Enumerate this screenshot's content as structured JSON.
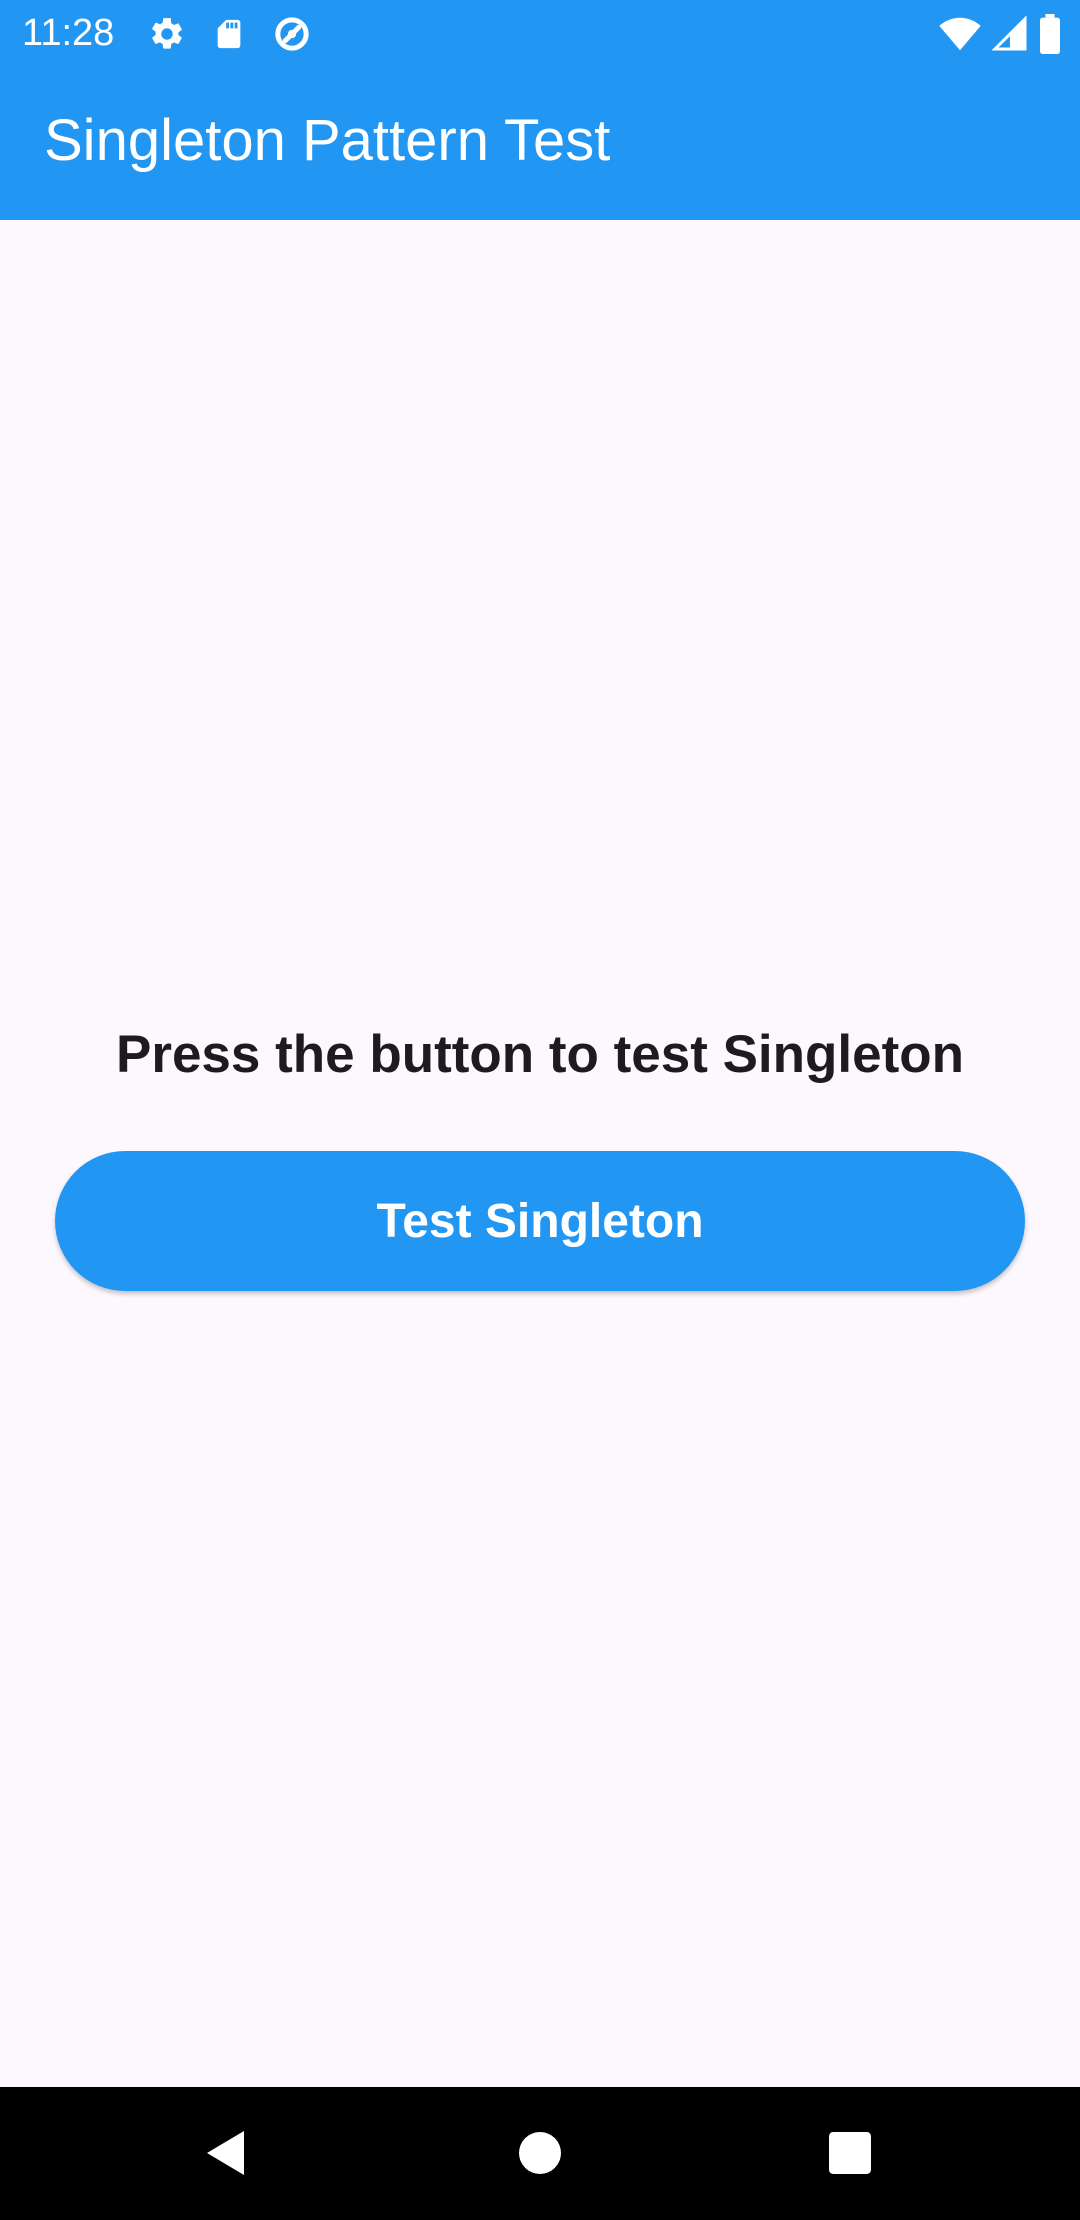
{
  "status_bar": {
    "time": "11:28",
    "left_icons": [
      "settings-icon",
      "sd-card-icon",
      "data-saver-icon"
    ],
    "right_icons": [
      "wifi-icon",
      "cell-signal-icon",
      "battery-icon"
    ]
  },
  "app_bar": {
    "title": "Singleton Pattern Test",
    "color": "#2196f3"
  },
  "main": {
    "prompt": "Press the button to test Singleton",
    "button_label": "Test Singleton"
  },
  "nav_bar": {
    "buttons": [
      "back-icon",
      "home-icon",
      "recents-icon"
    ]
  },
  "colors": {
    "primary": "#2196f3",
    "background": "#fdf7fe",
    "text": "#1d1b20"
  }
}
